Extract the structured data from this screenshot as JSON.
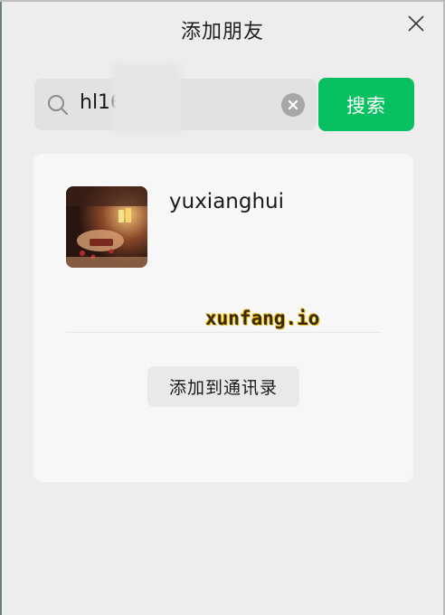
{
  "window": {
    "title": "添加朋友"
  },
  "search": {
    "value": "hl16",
    "button_label": "搜索"
  },
  "result": {
    "username": "yuxianghui"
  },
  "watermark": {
    "text": "xunfang.io"
  },
  "actions": {
    "add_contact_label": "添加到通讯录"
  },
  "colors": {
    "accent": "#07c160"
  }
}
